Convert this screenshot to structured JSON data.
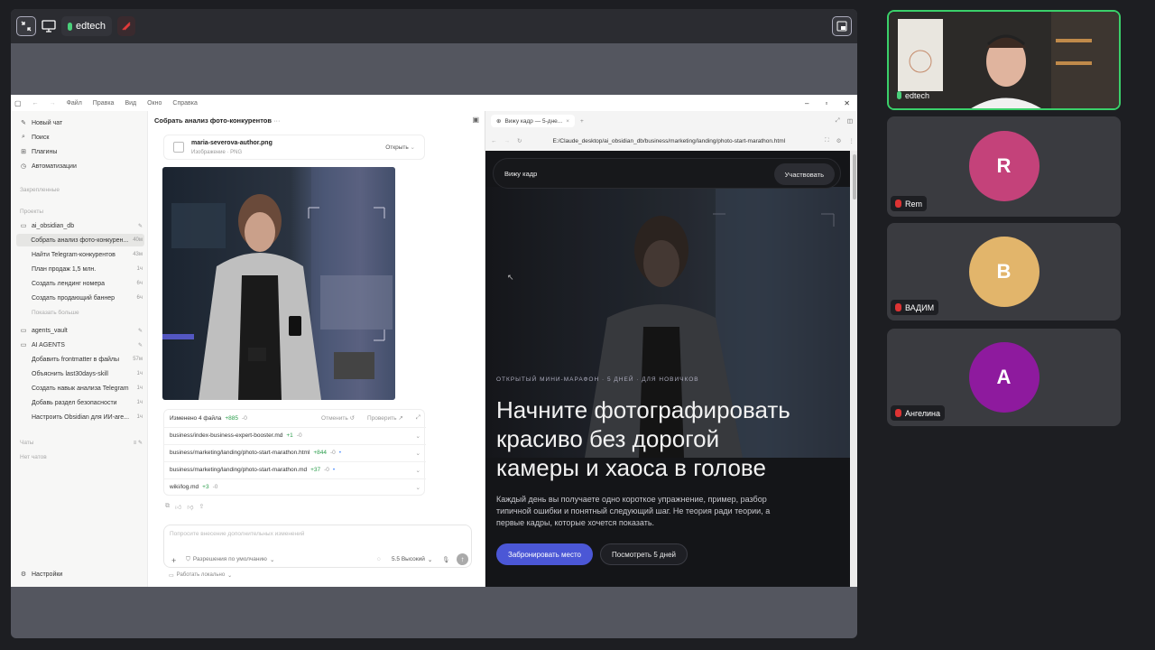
{
  "toolbar": {
    "mic_name": "edtech"
  },
  "app": {
    "menu": [
      "Файл",
      "Правка",
      "Вид",
      "Окно",
      "Справка"
    ],
    "sidebar": {
      "top_items": [
        {
          "label": "Новый чат",
          "icon": "edit-icon"
        },
        {
          "label": "Поиск",
          "icon": "search-icon"
        },
        {
          "label": "Плагины",
          "icon": "grid-icon"
        },
        {
          "label": "Автоматизации",
          "icon": "clock-icon"
        }
      ],
      "pinned_label": "Закрепленные",
      "projects_label": "Проекты",
      "project_name": "ai_obsidian_db",
      "project_items": [
        {
          "label": "Собрать анализ фото-конкурен...",
          "time": "40м"
        },
        {
          "label": "Найти Telegram-конкурентов",
          "time": "43м"
        },
        {
          "label": "План продаж 1,5 млн.",
          "time": "1ч"
        },
        {
          "label": "Создать лендинг номера",
          "time": "6ч"
        },
        {
          "label": "Создать продающий баннер",
          "time": "6ч"
        }
      ],
      "show_more": "Показать больше",
      "agents_vault": "agents_vault",
      "ai_agents": "AI AGENTS",
      "agent_items": [
        {
          "label": "Добавить frontmatter в файлы",
          "time": "57м"
        },
        {
          "label": "Объяснить last30days-skill",
          "time": "1ч"
        },
        {
          "label": "Создать навык анализа Telegram",
          "time": "1ч"
        },
        {
          "label": "Добавь раздел безопасности",
          "time": "1ч"
        },
        {
          "label": "Настроить Obsidian для ИИ-аге...",
          "time": "1ч"
        }
      ],
      "chats_label": "Чаты",
      "no_chats": "Нет чатов",
      "settings": "Настройки"
    },
    "chat": {
      "title": "Собрать анализ фото-конкурентов",
      "file_name": "maria-severova-author.png",
      "file_type": "Изображение · PNG",
      "open_btn": "Открыть",
      "changes": {
        "summary": "Изменено 4 файла",
        "added": "+885",
        "removed": "-0",
        "undo": "Отменить",
        "review": "Проверить",
        "files": [
          {
            "path": "business/index-business-expert-booster.md",
            "added": "+1",
            "removed": "-0"
          },
          {
            "path": "business/marketing/landing/photo-start-marathon.html",
            "added": "+844",
            "removed": "-0"
          },
          {
            "path": "business/marketing/landing/photo-start-marathon.md",
            "added": "+37",
            "removed": "-0"
          },
          {
            "path": "wiki/log.md",
            "added": "+3",
            "removed": "-0"
          }
        ]
      },
      "input_placeholder": "Попросите внесение дополнительных изменений",
      "permissions": "Разрешения по умолчанию",
      "model": "5.5 Высокий",
      "work_mode": "Работать локально"
    },
    "browser": {
      "tab_title": "Вижу кадр — 5-дне...",
      "url": "E:/Claude_desktop/ai_obsidian_db/business/marketing/landing/photo-start-marathon.html",
      "page": {
        "brand": "Вижу кадр",
        "cta_top": "Участвовать",
        "eyebrow": "ОТКРЫТЫЙ МИНИ-МАРАФОН · 5 ДНЕЙ · ДЛЯ НОВИЧКОВ",
        "headline_1": "Начните фотографировать",
        "headline_2": "красиво без дорогой",
        "headline_3": "камеры и хаоса в голове",
        "body_1": "Каждый день вы получаете одно короткое упражнение, пример, разбор",
        "body_2": "типичной ошибки и понятный следующий шаг. Не теория ради теории, а",
        "body_3": "первые кадры, которые хочется показать.",
        "btn_primary": "Забронировать место",
        "btn_secondary": "Посмотреть 5 дней"
      }
    }
  },
  "participants": [
    {
      "name": "edtech",
      "initial": "",
      "color": "#2b2b2b"
    },
    {
      "name": "Rem",
      "initial": "R",
      "color": "#c4427a"
    },
    {
      "name": "ВАДИМ",
      "initial": "B",
      "color": "#e2b56b"
    },
    {
      "name": "Ангелина",
      "initial": "A",
      "color": "#8e1a9e"
    }
  ]
}
